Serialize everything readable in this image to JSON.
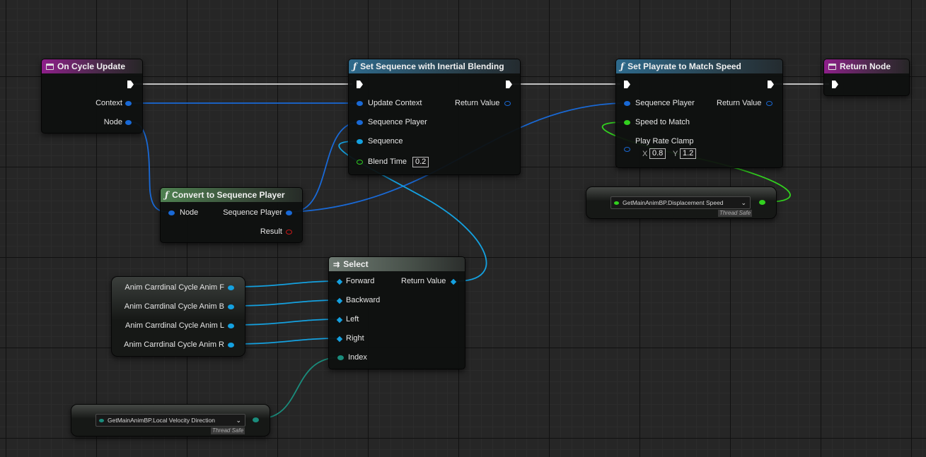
{
  "nodes": {
    "on_cycle_update": {
      "title": "On Cycle Update",
      "pins": {
        "context": "Context",
        "node": "Node"
      }
    },
    "set_sequence": {
      "title": "Set Sequence with Inertial Blending",
      "pins": {
        "update_context": "Update Context",
        "sequence_player": "Sequence Player",
        "sequence": "Sequence",
        "blend_time": "Blend Time",
        "return_value": "Return Value"
      },
      "blend_time_value": "0.2"
    },
    "set_playrate": {
      "title": "Set Playrate to Match Speed",
      "pins": {
        "sequence_player": "Sequence Player",
        "speed_to_match": "Speed to Match",
        "play_rate_clamp": "Play Rate Clamp",
        "return_value": "Return Value"
      },
      "clamp_x_label": "X",
      "clamp_x": "0.8",
      "clamp_y_label": "Y",
      "clamp_y": "1.2"
    },
    "return_node": {
      "title": "Return Node"
    },
    "convert": {
      "title": "Convert to Sequence Player",
      "pins": {
        "node": "Node",
        "sequence_player": "Sequence Player",
        "result": "Result"
      }
    },
    "select": {
      "title": "Select",
      "pins": {
        "forward": "Forward",
        "backward": "Backward",
        "left": "Left",
        "right": "Right",
        "index": "Index",
        "return_value": "Return Value"
      }
    },
    "anim_vars": [
      "Anim Carrdinal Cycle Anim F",
      "Anim Carrdinal Cycle Anim B",
      "Anim Carrdinal Cycle Anim L",
      "Anim Carrdinal Cycle Anim R"
    ],
    "getter_speed": {
      "label": "GetMainAnimBP.Displacement Speed",
      "badge": "Thread Safe"
    },
    "getter_direction": {
      "label": "GetMainAnimBP.Local Velocity Direction",
      "badge": "Thread Safe"
    }
  },
  "colors": {
    "exec": "#ffffff",
    "struct": "#1969d6",
    "object": "#14a1e0",
    "float": "#32d11f",
    "enum": "#1a8c7c",
    "bool": "#cc1a1a",
    "event_header": "#8e1f8a",
    "function_header": "#2e6a8c"
  },
  "icons": {
    "event": "event-icon",
    "function": "function-icon",
    "select": "select-icon",
    "dropdown": "chevron-down-icon"
  }
}
